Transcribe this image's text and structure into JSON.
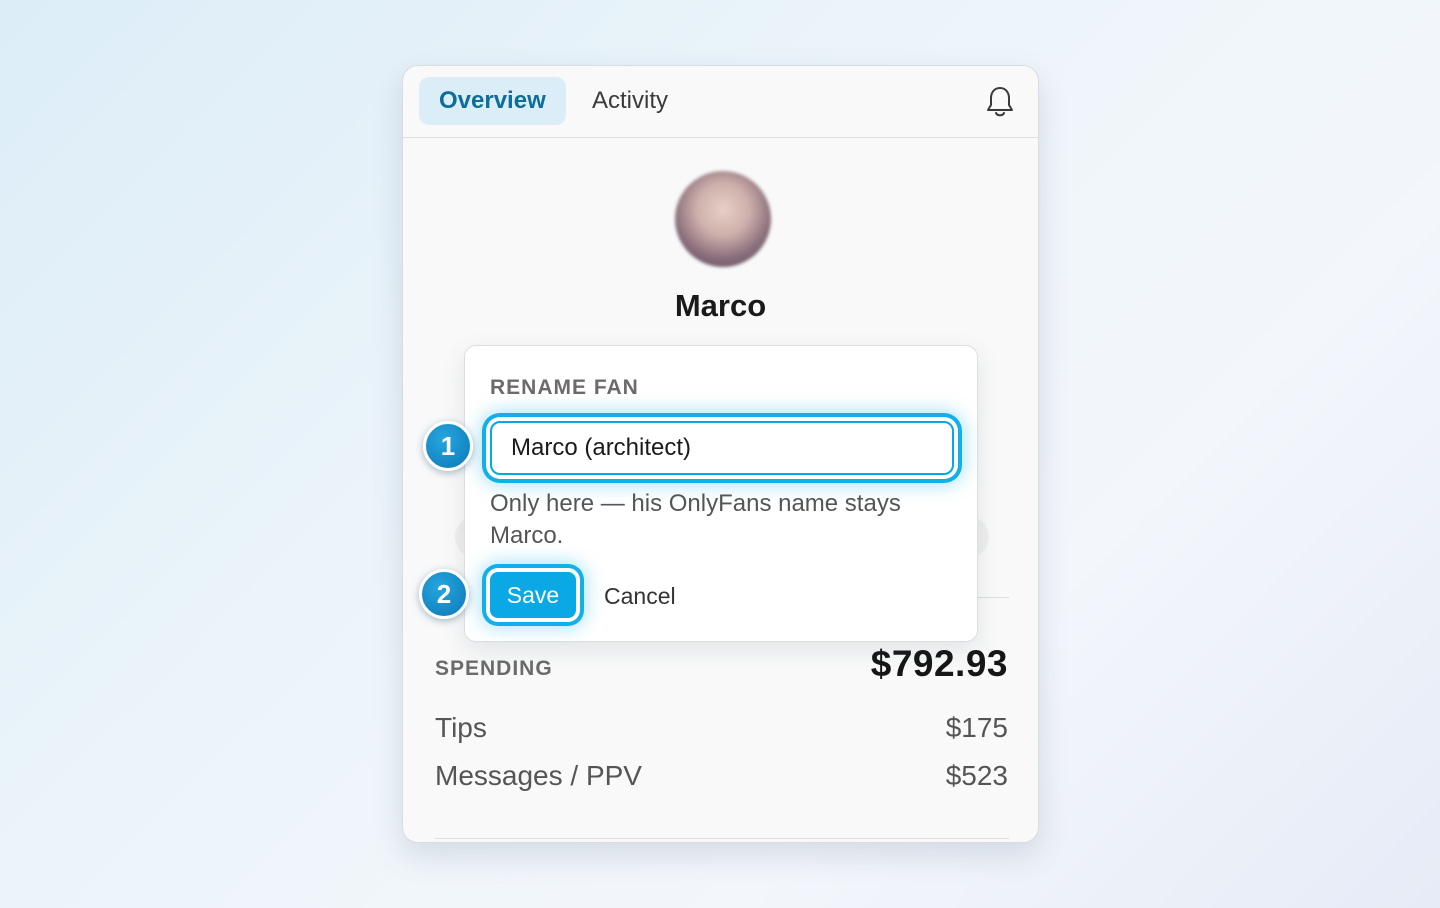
{
  "tabs": [
    {
      "label": "Overview",
      "active": true
    },
    {
      "label": "Activity",
      "active": false
    }
  ],
  "header": {
    "notification_icon": "bell-icon"
  },
  "profile": {
    "name": "Marco",
    "avatar": "blurred profile photo"
  },
  "rename": {
    "title": "RENAME FAN",
    "input_value": "Marco (architect)",
    "hint": "Only here — his OnlyFans name stays Marco.",
    "save_label": "Save",
    "cancel_label": "Cancel"
  },
  "steps": [
    "1",
    "2"
  ],
  "spending": {
    "label": "SPENDING",
    "total": "$792.93",
    "rows": [
      {
        "label": "Tips",
        "value": "$175"
      },
      {
        "label": "Messages / PPV",
        "value": "$523"
      }
    ]
  },
  "colors": {
    "accent": "#0aa9e6",
    "tab_active_bg": "#dbeef8",
    "tab_active_text": "#0e6e9a"
  }
}
